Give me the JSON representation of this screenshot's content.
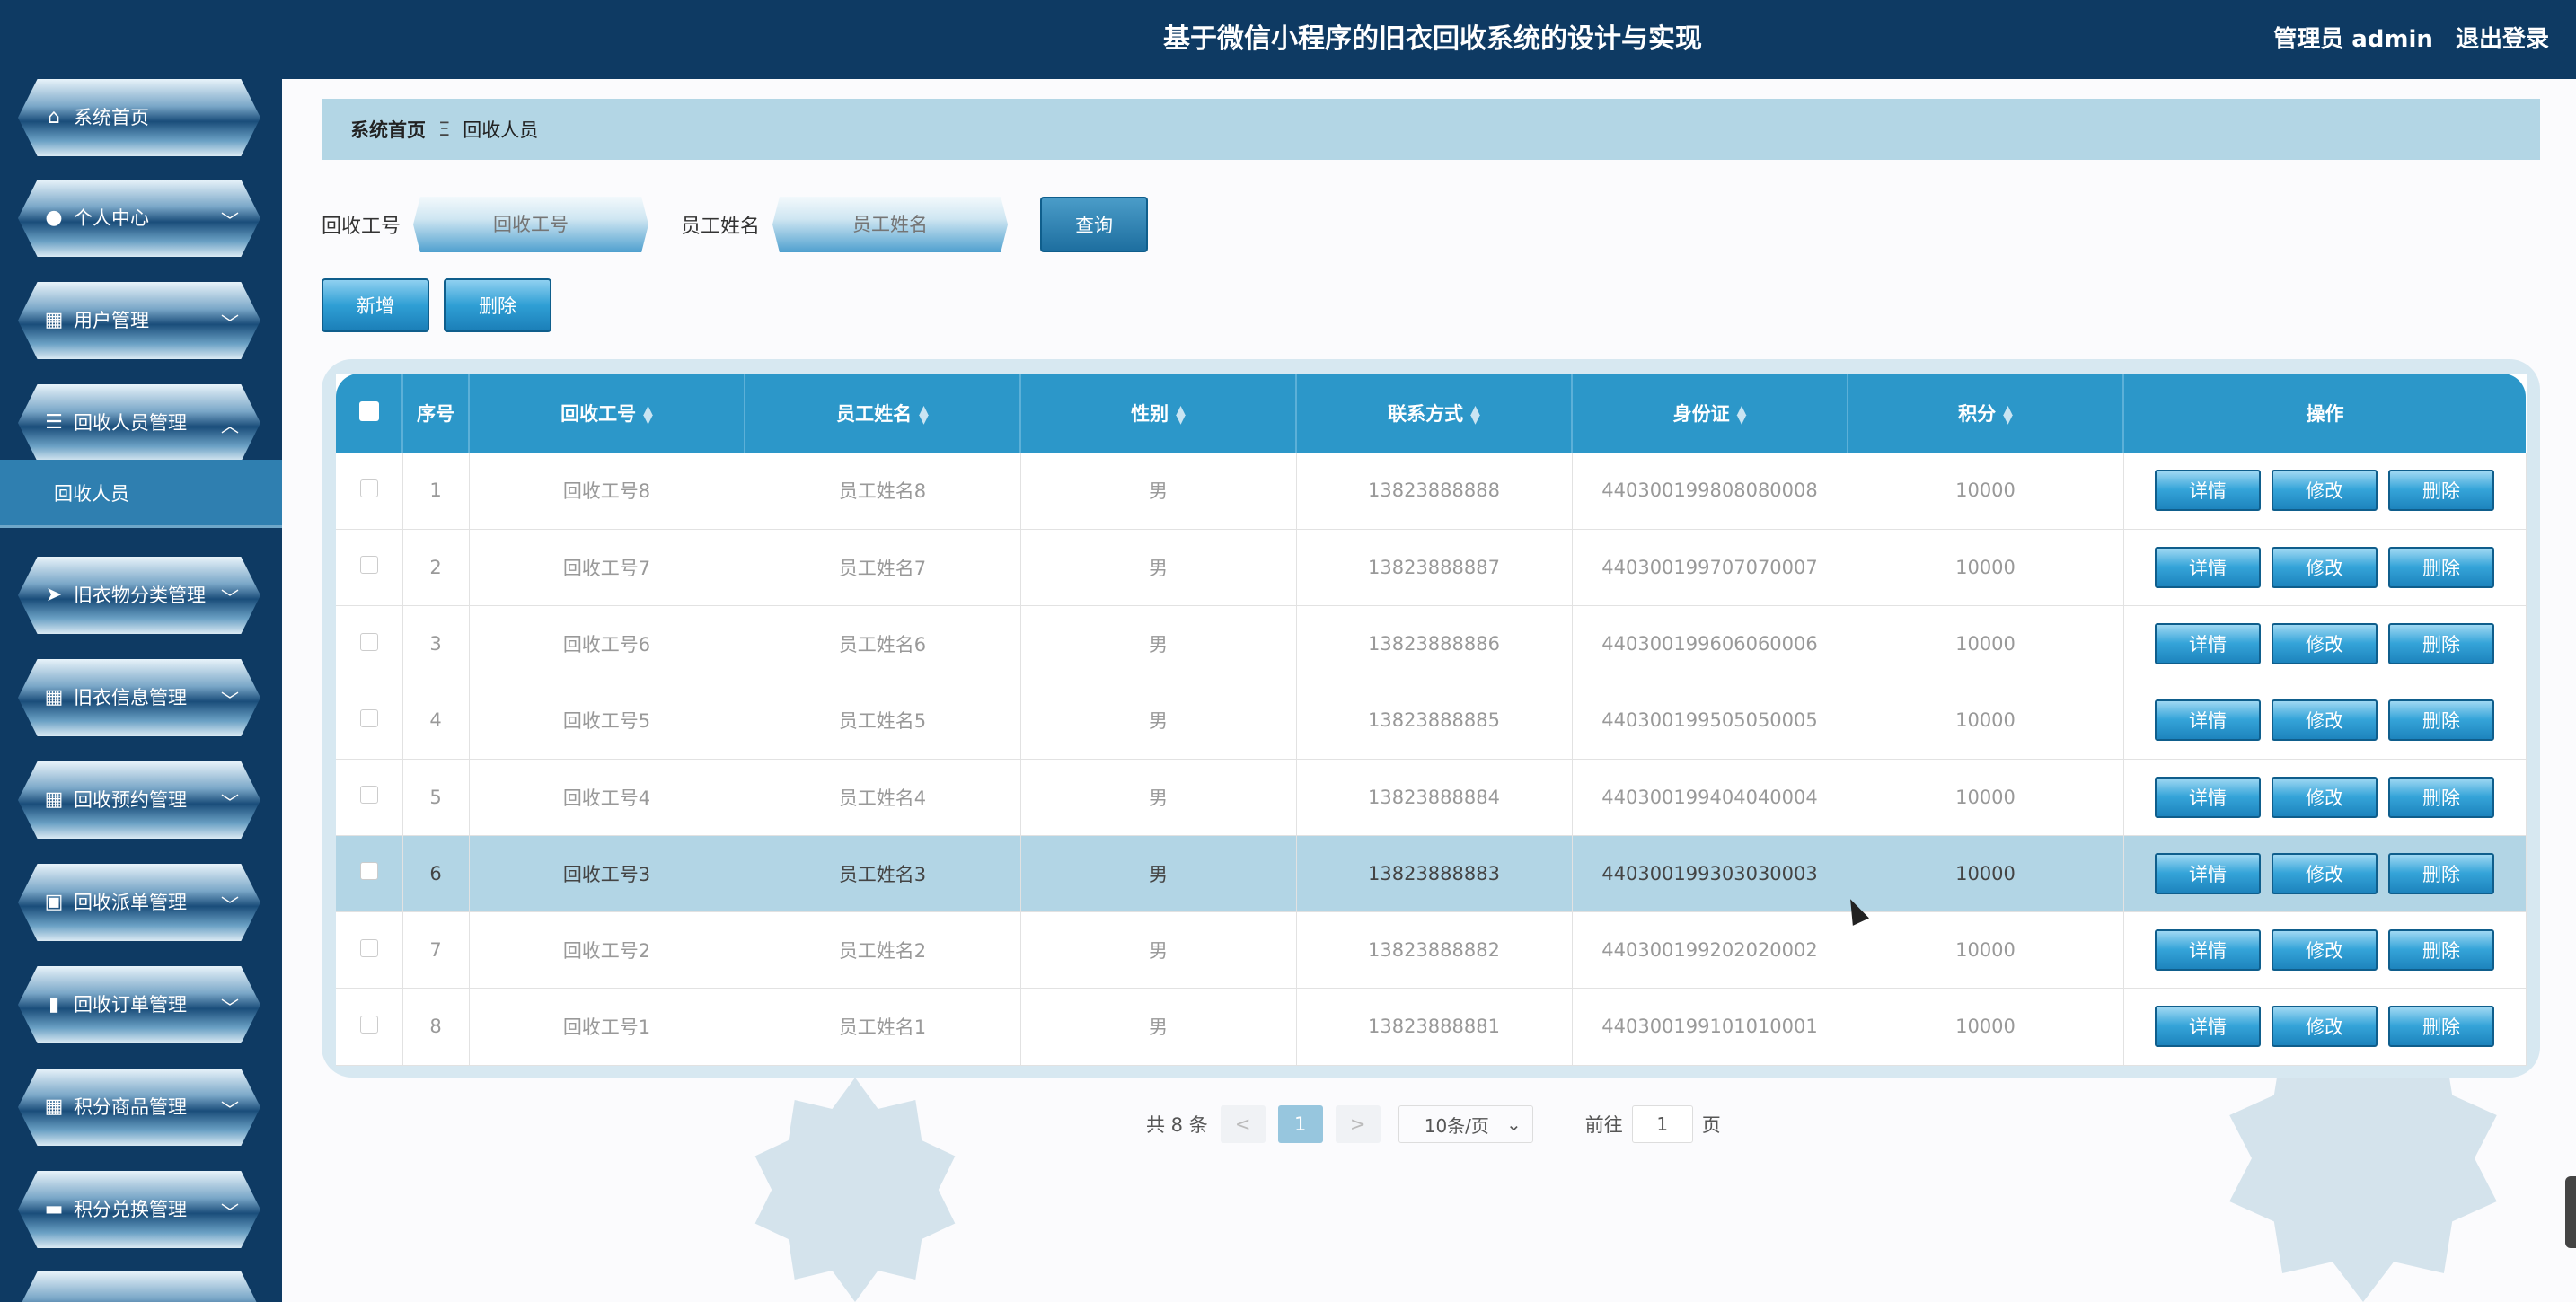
{
  "header": {
    "title": "基于微信小程序的旧衣回收系统的设计与实现",
    "user_label": "管理员 admin",
    "logout_label": "退出登录"
  },
  "sidebar": {
    "items": [
      {
        "label": "系统首页",
        "icon": "home-icon"
      },
      {
        "label": "个人中心",
        "icon": "person-icon"
      },
      {
        "label": "用户管理",
        "icon": "grid-icon"
      },
      {
        "label": "回收人员管理",
        "icon": "list-icon"
      },
      {
        "label": "旧衣物分类管理",
        "icon": "send-icon"
      },
      {
        "label": "旧衣信息管理",
        "icon": "grid-icon"
      },
      {
        "label": "回收预约管理",
        "icon": "grid-icon"
      },
      {
        "label": "回收派单管理",
        "icon": "clipboard-icon"
      },
      {
        "label": "回收订单管理",
        "icon": "book-icon"
      },
      {
        "label": "积分商品管理",
        "icon": "grid-icon"
      },
      {
        "label": "积分兑换管理",
        "icon": "monitor-icon"
      }
    ],
    "submenu_label": "回收人员"
  },
  "breadcrumb": {
    "home": "系统首页",
    "separator": "Ξ",
    "current": "回收人员"
  },
  "search": {
    "field1_label": "回收工号",
    "field1_placeholder": "回收工号",
    "field2_label": "员工姓名",
    "field2_placeholder": "员工姓名",
    "query_label": "查询"
  },
  "actions": {
    "add_label": "新增",
    "delete_label": "删除"
  },
  "table": {
    "columns": [
      "序号",
      "回收工号",
      "员工姓名",
      "性别",
      "联系方式",
      "身份证",
      "积分",
      "操作"
    ],
    "rows": [
      {
        "index": "1",
        "worker_no": "回收工号8",
        "name": "员工姓名8",
        "gender": "男",
        "phone": "13823888888",
        "id_card": "440300199808080008",
        "points": "10000"
      },
      {
        "index": "2",
        "worker_no": "回收工号7",
        "name": "员工姓名7",
        "gender": "男",
        "phone": "13823888887",
        "id_card": "440300199707070007",
        "points": "10000"
      },
      {
        "index": "3",
        "worker_no": "回收工号6",
        "name": "员工姓名6",
        "gender": "男",
        "phone": "13823888886",
        "id_card": "440300199606060006",
        "points": "10000"
      },
      {
        "index": "4",
        "worker_no": "回收工号5",
        "name": "员工姓名5",
        "gender": "男",
        "phone": "13823888885",
        "id_card": "440300199505050005",
        "points": "10000"
      },
      {
        "index": "5",
        "worker_no": "回收工号4",
        "name": "员工姓名4",
        "gender": "男",
        "phone": "13823888884",
        "id_card": "440300199404040004",
        "points": "10000"
      },
      {
        "index": "6",
        "worker_no": "回收工号3",
        "name": "员工姓名3",
        "gender": "男",
        "phone": "13823888883",
        "id_card": "440300199303030003",
        "points": "10000"
      },
      {
        "index": "7",
        "worker_no": "回收工号2",
        "name": "员工姓名2",
        "gender": "男",
        "phone": "13823888882",
        "id_card": "440300199202020002",
        "points": "10000"
      },
      {
        "index": "8",
        "worker_no": "回收工号1",
        "name": "员工姓名1",
        "gender": "男",
        "phone": "13823888881",
        "id_card": "440300199101010001",
        "points": "10000"
      }
    ],
    "op_detail": "详情",
    "op_edit": "修改",
    "op_delete": "删除"
  },
  "pagination": {
    "total_text": "共 8 条",
    "prev": "<",
    "current_page": "1",
    "next": ">",
    "page_size": "10条/页",
    "goto_label": "前往",
    "goto_value": "1",
    "page_suffix": "页"
  },
  "colors": {
    "header_bg": "#0e3a63",
    "accent": "#2c97c9",
    "highlight_row": "#b2d5e5"
  }
}
